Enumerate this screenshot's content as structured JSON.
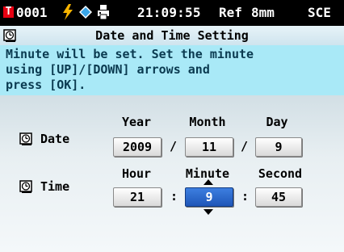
{
  "status": {
    "target_badge": "T",
    "target_number": "0001",
    "clock": "21:09:55",
    "mode": "Ref",
    "aperture": "8mm",
    "specular": "SCE"
  },
  "title": "Date and Time Setting",
  "message": {
    "line1": "Minute will be set. Set the minute",
    "line2": "using [UP]/[DOWN] arrows and",
    "line3": "press [OK]."
  },
  "date": {
    "label": "Date",
    "year_label": "Year",
    "month_label": "Month",
    "day_label": "Day",
    "year": "2009",
    "month": "11",
    "day": "9",
    "sep1": "/",
    "sep2": "/"
  },
  "time": {
    "label": "Time",
    "hour_label": "Hour",
    "minute_label": "Minute",
    "second_label": "Second",
    "hour": "21",
    "minute": "9",
    "second": "45",
    "sep1": ":",
    "sep2": ":"
  },
  "selected_field": "minute",
  "colors": {
    "status_bg": "#000000",
    "badge": "#e60012",
    "message_bg": "#a9e9f7",
    "selected_field": "#2a66c8"
  },
  "icons": [
    "flash-icon",
    "diamond-icon",
    "printer-icon",
    "clock-icon"
  ]
}
